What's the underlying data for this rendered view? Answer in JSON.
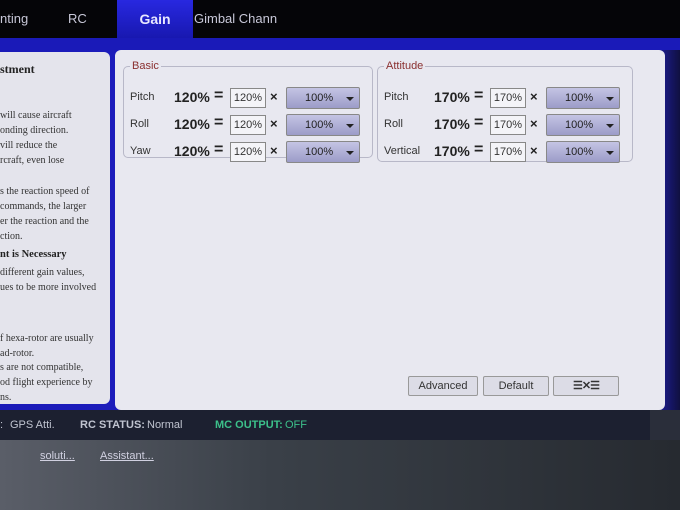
{
  "tabs": [
    {
      "label": "nting"
    },
    {
      "label": "RC"
    },
    {
      "label": "Gain",
      "active": true
    },
    {
      "label": "Gimbal Chann"
    }
  ],
  "help": {
    "lines": [
      {
        "t": "stment",
        "c": "h"
      },
      {
        "t": "will cause aircraft",
        "c": ""
      },
      {
        "t": "onding direction.",
        "c": ""
      },
      {
        "t": "vill reduce the",
        "c": ""
      },
      {
        "t": "rcraft, even lose",
        "c": ""
      },
      {
        "t": "s the reaction speed of",
        "c": ""
      },
      {
        "t": " commands, the larger",
        "c": ""
      },
      {
        "t": "er the reaction and the",
        "c": ""
      },
      {
        "t": "ction.",
        "c": ""
      },
      {
        "t": "nt is Necessary",
        "c": "h2"
      },
      {
        "t": " different gain values,",
        "c": ""
      },
      {
        "t": "ues to be more involved",
        "c": ""
      },
      {
        "t": "f hexa-rotor are usually",
        "c": ""
      },
      {
        "t": "ad-rotor.",
        "c": ""
      },
      {
        "t": "s are not compatible,",
        "c": ""
      },
      {
        "t": "od flight experience by",
        "c": ""
      },
      {
        "t": "ns.",
        "c": ""
      }
    ]
  },
  "basic": {
    "title": "Basic",
    "rows": [
      {
        "label": "Pitch",
        "total": "120%",
        "base": "120%",
        "multiplier": "100%"
      },
      {
        "label": "Roll",
        "total": "120%",
        "base": "120%",
        "multiplier": "100%"
      },
      {
        "label": "Yaw",
        "total": "120%",
        "base": "120%",
        "multiplier": "100%"
      }
    ]
  },
  "attitude": {
    "title": "Attitude",
    "rows": [
      {
        "label": "Pitch",
        "total": "170%",
        "base": "170%",
        "multiplier": "100%"
      },
      {
        "label": "Roll",
        "total": "170%",
        "base": "170%",
        "multiplier": "100%"
      },
      {
        "label": "Vertical",
        "total": "170%",
        "base": "170%",
        "multiplier": "100%"
      }
    ]
  },
  "symbols": {
    "eq": "=",
    "times": "×"
  },
  "buttons": {
    "advanced": "Advanced",
    "default": "Default",
    "swap_icon": "swap-arrows-icon"
  },
  "status": {
    "mode_value": "GPS Atti.",
    "rc_label": "RC STATUS:",
    "rc_value": "Normal",
    "mc_label": "MC OUTPUT:",
    "mc_value": "OFF",
    "mc_color": "#3cc08a"
  },
  "below": {
    "link": "Assistant...",
    "link2": "soluti..."
  }
}
